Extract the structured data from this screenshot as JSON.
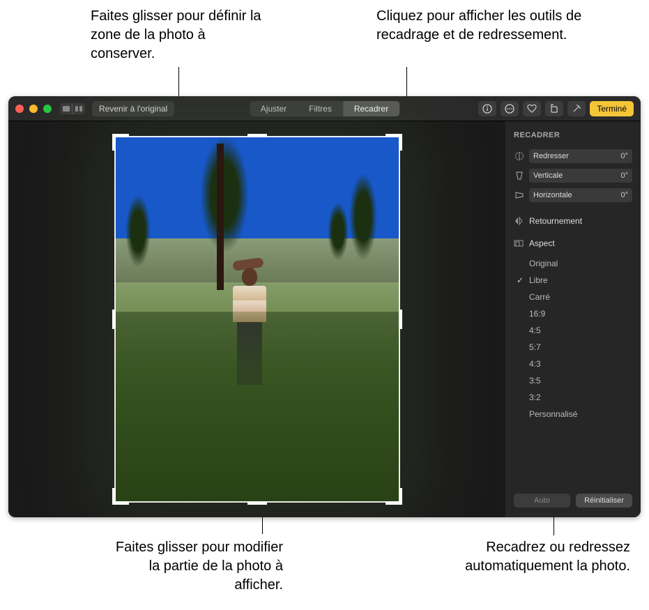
{
  "callouts": {
    "topLeft": "Faites glisser pour définir la zone de la photo à conserver.",
    "topRight": "Cliquez pour afficher les outils de recadrage et de redressement.",
    "bottomLeft": "Faites glisser pour modifier la partie de la photo à afficher.",
    "bottomRight": "Recadrez ou redressez automatiquement la photo."
  },
  "toolbar": {
    "revert": "Revenir à l'original",
    "tabs": {
      "adjust": "Ajuster",
      "filters": "Filtres",
      "crop": "Recadrer"
    },
    "done": "Terminé"
  },
  "sidebar": {
    "title": "RECADRER",
    "sliders": {
      "straighten": {
        "label": "Redresser",
        "value": "0°"
      },
      "vertical": {
        "label": "Verticale",
        "value": "0°"
      },
      "horizontal": {
        "label": "Horizontale",
        "value": "0°"
      }
    },
    "flip": "Retournement",
    "aspect": {
      "label": "Aspect",
      "options": [
        "Original",
        "Libre",
        "Carré",
        "16:9",
        "4:5",
        "5:7",
        "4:3",
        "3:5",
        "3:2",
        "Personnalisé"
      ],
      "selected": "Libre"
    },
    "footer": {
      "auto": "Auto",
      "reset": "Réinitialiser"
    }
  }
}
